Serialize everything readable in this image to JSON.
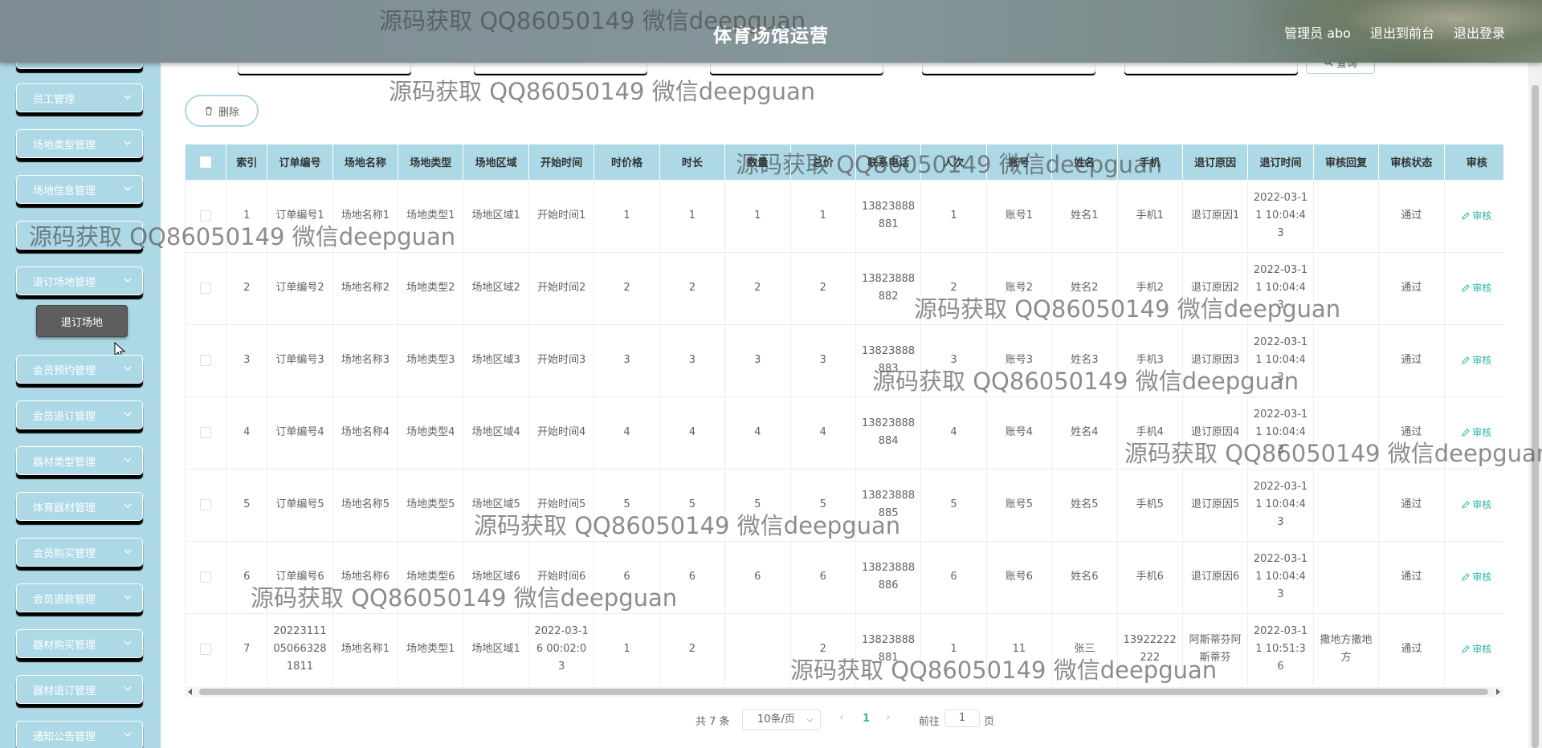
{
  "header": {
    "title": "体育场馆运营",
    "admin": "管理员 abo",
    "to_front": "退出到前台",
    "logout": "退出登录"
  },
  "sidebar": {
    "items": [
      {
        "label": "员工管理"
      },
      {
        "label": "场地类型管理"
      },
      {
        "label": "场地信息管理"
      },
      {
        "label": "退订场地管理"
      },
      {
        "label": "会员预约管理"
      },
      {
        "label": "会员退订管理"
      },
      {
        "label": "器材类型管理"
      },
      {
        "label": "体育器材管理"
      },
      {
        "label": "会员购买管理"
      },
      {
        "label": "会员退款管理"
      },
      {
        "label": "器材购买管理"
      },
      {
        "label": "器材退订管理"
      },
      {
        "label": "通知公告管理"
      }
    ],
    "submenu_label": "退订场地"
  },
  "toolbar": {
    "search_label": "查询",
    "delete_label": "删除"
  },
  "table": {
    "columns": [
      "索引",
      "订单编号",
      "场地名称",
      "场地类型",
      "场地区域",
      "开始时间",
      "时价格",
      "时长",
      "数量",
      "总价",
      "联系电话",
      "人次",
      "账号",
      "姓名",
      "手机",
      "退订原因",
      "退订时间",
      "审核回复",
      "审核状态",
      "审核"
    ],
    "action_label": "审核",
    "rows": [
      [
        "1",
        "订单编号1",
        "场地名称1",
        "场地类型1",
        "场地区域1",
        "开始时间1",
        "1",
        "1",
        "1",
        "1",
        "13823888881",
        "1",
        "账号1",
        "姓名1",
        "手机1",
        "退订原因1",
        "2022-03-11 10:04:43",
        "",
        "通过"
      ],
      [
        "2",
        "订单编号2",
        "场地名称2",
        "场地类型2",
        "场地区域2",
        "开始时间2",
        "2",
        "2",
        "2",
        "2",
        "13823888882",
        "2",
        "账号2",
        "姓名2",
        "手机2",
        "退订原因2",
        "2022-03-11 10:04:43",
        "",
        "通过"
      ],
      [
        "3",
        "订单编号3",
        "场地名称3",
        "场地类型3",
        "场地区域3",
        "开始时间3",
        "3",
        "3",
        "3",
        "3",
        "13823888883",
        "3",
        "账号3",
        "姓名3",
        "手机3",
        "退订原因3",
        "2022-03-11 10:04:43",
        "",
        "通过"
      ],
      [
        "4",
        "订单编号4",
        "场地名称4",
        "场地类型4",
        "场地区域4",
        "开始时间4",
        "4",
        "4",
        "4",
        "4",
        "13823888884",
        "4",
        "账号4",
        "姓名4",
        "手机4",
        "退订原因4",
        "2022-03-11 10:04:43",
        "",
        "通过"
      ],
      [
        "5",
        "订单编号5",
        "场地名称5",
        "场地类型5",
        "场地区域5",
        "开始时间5",
        "5",
        "5",
        "5",
        "5",
        "13823888885",
        "5",
        "账号5",
        "姓名5",
        "手机5",
        "退订原因5",
        "2022-03-11 10:04:43",
        "",
        "通过"
      ],
      [
        "6",
        "订单编号6",
        "场地名称6",
        "场地类型6",
        "场地区域6",
        "开始时间6",
        "6",
        "6",
        "6",
        "6",
        "13823888886",
        "6",
        "账号6",
        "姓名6",
        "手机6",
        "退订原因6",
        "2022-03-11 10:04:43",
        "",
        "通过"
      ],
      [
        "7",
        "20223111050663281811",
        "场地名称1",
        "场地类型1",
        "场地区域1",
        "2022-03-16 00:02:03",
        "1",
        "2",
        "",
        "2",
        "13823888881",
        "1",
        "11",
        "张三",
        "13922222222",
        "阿斯蒂芬阿斯蒂芬",
        "2022-03-11 10:51:36",
        "撒地方撒地方",
        "通过"
      ]
    ]
  },
  "pagination": {
    "total": "共 7 条",
    "page_size": "10条/页",
    "current": "1",
    "goto": "前往",
    "goto_value": "1",
    "page_word": "页"
  },
  "watermark": "源码获取 QQ86050149 微信deepguan",
  "colors": {
    "accent": "#add8e6",
    "link": "#2ab7a9",
    "submenu_bg": "#5e5e5e"
  }
}
